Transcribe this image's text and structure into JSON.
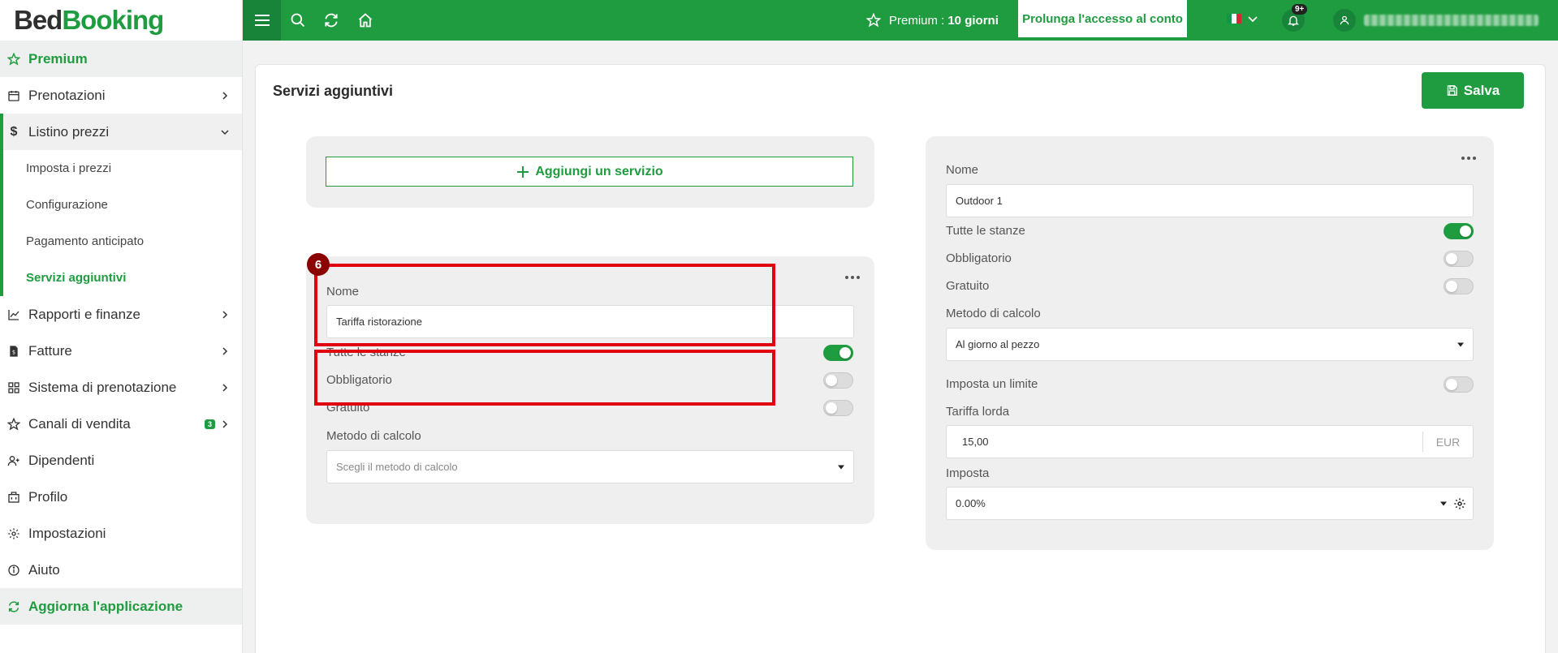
{
  "brand": {
    "part1": "Bed",
    "part2": "Booking"
  },
  "sidebar": {
    "premium": "Premium",
    "items": [
      {
        "label": "Prenotazioni"
      },
      {
        "label": "Listino prezzi"
      },
      {
        "label": "Rapporti e finanze"
      },
      {
        "label": "Fatture"
      },
      {
        "label": "Sistema di prenotazione"
      },
      {
        "label": "Canali di vendita",
        "badge": "3"
      },
      {
        "label": "Dipendenti"
      },
      {
        "label": "Profilo"
      },
      {
        "label": "Impostazioni"
      },
      {
        "label": "Aiuto"
      }
    ],
    "sub_items": [
      {
        "label": "Imposta i prezzi"
      },
      {
        "label": "Configurazione"
      },
      {
        "label": "Pagamento anticipato"
      },
      {
        "label": "Servizi aggiuntivi"
      }
    ],
    "update_app": "Aggiorna l'applicazione"
  },
  "topbar": {
    "premium_label": "Premium :",
    "premium_days": "10 giorni",
    "extend_button": "Prolunga l'accesso al conto",
    "notifications_badge": "9+"
  },
  "page": {
    "title": "Servizi aggiuntivi",
    "save_button": "Salva",
    "add_service_button": "Aggiungi un servizio",
    "step_number": "6"
  },
  "new_service": {
    "name_label": "Nome",
    "name_value": "Tariffa ristorazione",
    "all_rooms_label": "Tutte le stanze",
    "all_rooms": true,
    "mandatory_label": "Obbligatorio",
    "mandatory": false,
    "free_label": "Gratuito",
    "free": false,
    "calc_method_label": "Metodo di calcolo",
    "calc_method_placeholder": "Scegli il metodo di calcolo"
  },
  "existing_service": {
    "name_label": "Nome",
    "name_value": "Outdoor 1",
    "all_rooms_label": "Tutte le stanze",
    "all_rooms": true,
    "mandatory_label": "Obbligatorio",
    "mandatory": false,
    "free_label": "Gratuito",
    "free": false,
    "calc_method_label": "Metodo di calcolo",
    "calc_method_value": "Al giorno al pezzo",
    "limit_label": "Imposta un limite",
    "limit": false,
    "gross_rate_label": "Tariffa lorda",
    "gross_rate_value": "15,00",
    "gross_rate_unit": "EUR",
    "tax_label": "Imposta",
    "tax_value": "0.00%"
  },
  "colors": {
    "primary": "#1f9c3f",
    "highlight": "#e0000f",
    "step_badge": "#8b0000"
  }
}
